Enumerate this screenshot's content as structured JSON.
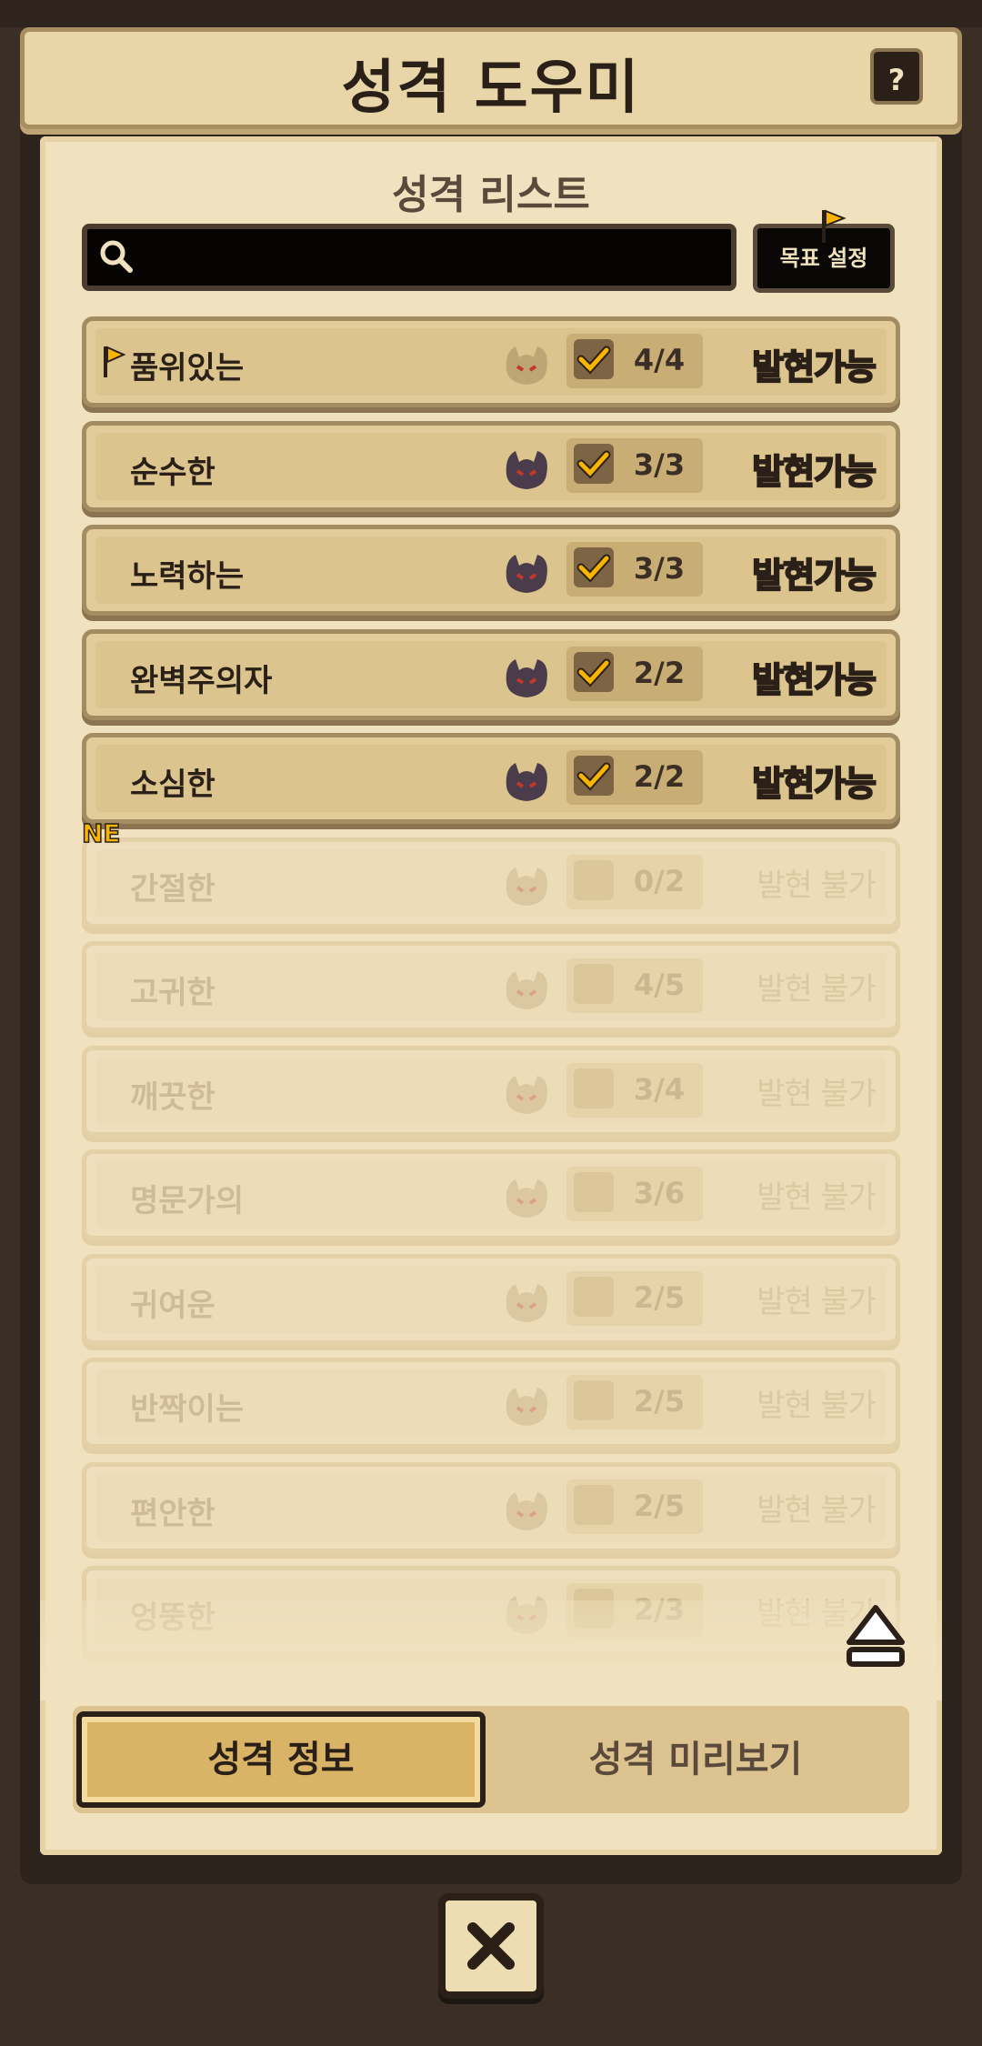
{
  "header": {
    "title": "성격 도우미",
    "help_label": "?"
  },
  "list_title": "성격 리스트",
  "search": {
    "value": ""
  },
  "target_button": {
    "label": "목표 설정"
  },
  "new_badge": "NE",
  "rows": [
    {
      "name": "품위있는",
      "count": "4/4",
      "status": "발현가능",
      "available": true,
      "flagged": true
    },
    {
      "name": "순수한",
      "count": "3/3",
      "status": "발현가능",
      "available": true
    },
    {
      "name": "노력하는",
      "count": "3/3",
      "status": "발현가능",
      "available": true
    },
    {
      "name": "완벽주의자",
      "count": "2/2",
      "status": "발현가능",
      "available": true
    },
    {
      "name": "소심한",
      "count": "2/2",
      "status": "발현가능",
      "available": true
    },
    {
      "name": "간절한",
      "count": "0/2",
      "status": "발현 불가",
      "available": false
    },
    {
      "name": "고귀한",
      "count": "4/5",
      "status": "발현 불가",
      "available": false
    },
    {
      "name": "깨끗한",
      "count": "3/4",
      "status": "발현 불가",
      "available": false
    },
    {
      "name": "명문가의",
      "count": "3/6",
      "status": "발현 불가",
      "available": false
    },
    {
      "name": "귀여운",
      "count": "2/5",
      "status": "발현 불가",
      "available": false
    },
    {
      "name": "반짝이는",
      "count": "2/5",
      "status": "발현 불가",
      "available": false
    },
    {
      "name": "편안한",
      "count": "2/5",
      "status": "발현 불가",
      "available": false
    },
    {
      "name": "엉뚱한",
      "count": "2/3",
      "status": "발현 불가",
      "available": false
    }
  ],
  "tabs": [
    {
      "label": "성격 정보",
      "active": true
    },
    {
      "label": "성격 미리보기",
      "active": false
    }
  ],
  "colors": {
    "accent": "#f7b500",
    "dark": "#2a2018",
    "paper": "#f1e2bf"
  }
}
